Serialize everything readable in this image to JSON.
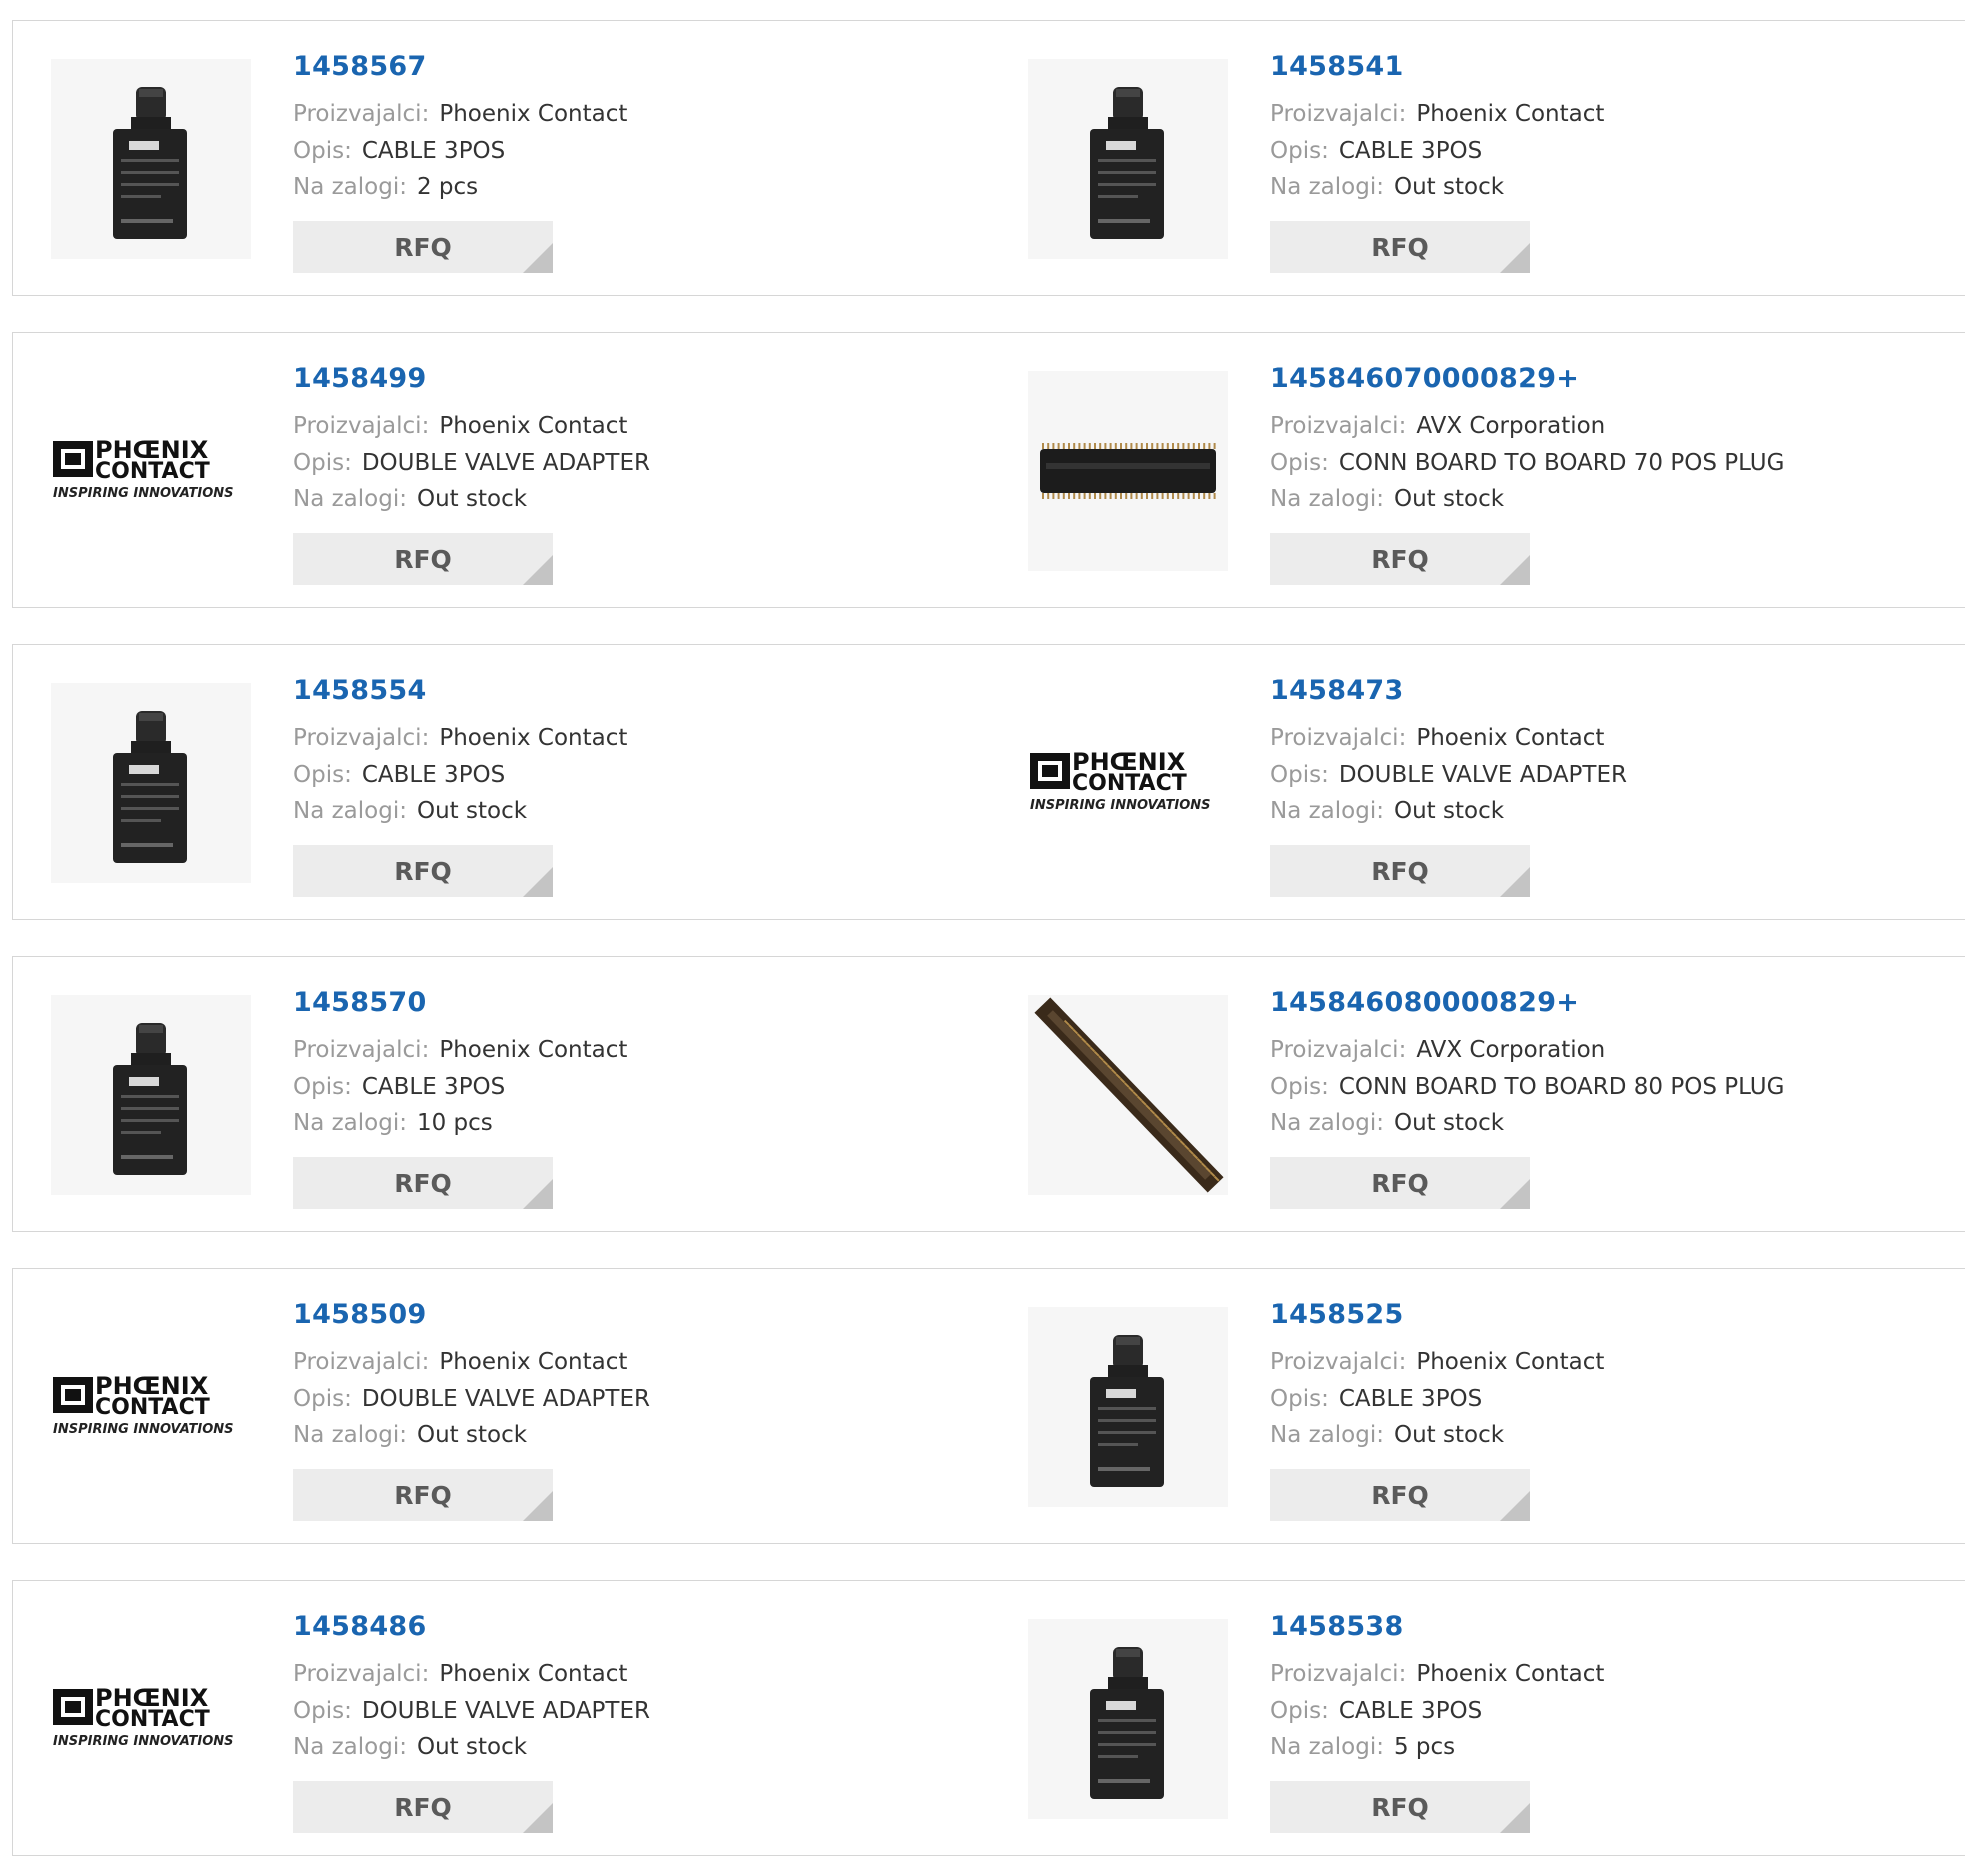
{
  "labels": {
    "manufacturer": "Proizvajalci:",
    "description": "Opis:",
    "stock": "Na zalogi:",
    "rfq": "RFQ"
  },
  "logo": {
    "line1": "PHŒNIX",
    "line2": "CONTACT",
    "tagline": "INSPIRING INNOVATIONS"
  },
  "colors": {
    "part_number": "#1a65b0",
    "label": "#9a9a9a",
    "value": "#333333",
    "button_bg": "#ececec",
    "border": "#d6d6d6"
  },
  "products": [
    {
      "part": "1458567",
      "manufacturer": "Phoenix Contact",
      "description": "CABLE 3POS",
      "stock": "2 pcs",
      "image": "valve-connector-photo"
    },
    {
      "part": "1458541",
      "manufacturer": "Phoenix Contact",
      "description": "CABLE 3POS",
      "stock": "Out stock",
      "image": "valve-connector-photo"
    },
    {
      "part": "1458499",
      "manufacturer": "Phoenix Contact",
      "description": "DOUBLE VALVE ADAPTER",
      "stock": "Out stock",
      "image": "phoenix-contact-logo"
    },
    {
      "part": "145846070000829+",
      "manufacturer": "AVX Corporation",
      "description": "CONN BOARD TO BOARD 70 POS PLUG",
      "stock": "Out stock",
      "image": "board-connector-photo"
    },
    {
      "part": "1458554",
      "manufacturer": "Phoenix Contact",
      "description": "CABLE 3POS",
      "stock": "Out stock",
      "image": "valve-connector-photo"
    },
    {
      "part": "1458473",
      "manufacturer": "Phoenix Contact",
      "description": "DOUBLE VALVE ADAPTER",
      "stock": "Out stock",
      "image": "phoenix-contact-logo"
    },
    {
      "part": "1458570",
      "manufacturer": "Phoenix Contact",
      "description": "CABLE 3POS",
      "stock": "10 pcs",
      "image": "valve-connector-photo"
    },
    {
      "part": "145846080000829+",
      "manufacturer": "AVX Corporation",
      "description": "CONN BOARD TO BOARD 80 POS PLUG",
      "stock": "Out stock",
      "image": "board-connector-diagonal-photo"
    },
    {
      "part": "1458509",
      "manufacturer": "Phoenix Contact",
      "description": "DOUBLE VALVE ADAPTER",
      "stock": "Out stock",
      "image": "phoenix-contact-logo"
    },
    {
      "part": "1458525",
      "manufacturer": "Phoenix Contact",
      "description": "CABLE 3POS",
      "stock": "Out stock",
      "image": "valve-connector-photo"
    },
    {
      "part": "1458486",
      "manufacturer": "Phoenix Contact",
      "description": "DOUBLE VALVE ADAPTER",
      "stock": "Out stock",
      "image": "phoenix-contact-logo"
    },
    {
      "part": "1458538",
      "manufacturer": "Phoenix Contact",
      "description": "CABLE 3POS",
      "stock": "5 pcs",
      "image": "valve-connector-photo"
    }
  ]
}
